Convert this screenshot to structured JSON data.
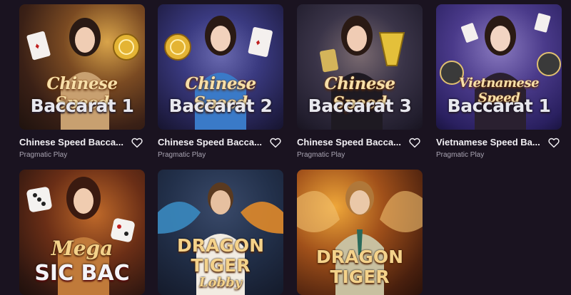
{
  "games": [
    {
      "name": "Chinese Speed Bacca...",
      "provider": "Pragmatic Play",
      "art_line1": "Chinese Speed",
      "art_line2": "Baccarat 1",
      "bg": "#4a2a1e",
      "bg2": "#b8862a"
    },
    {
      "name": "Chinese Speed Bacca...",
      "provider": "Pragmatic Play",
      "art_line1": "Chinese Speed",
      "art_line2": "Baccarat 2",
      "bg": "#2a2350",
      "bg2": "#3a6ab0"
    },
    {
      "name": "Chinese Speed Bacca...",
      "provider": "Pragmatic Play",
      "art_line1": "Chinese Speed",
      "art_line2": "Baccarat 3",
      "bg": "#2a2a3e",
      "bg2": "#6a5a2a"
    },
    {
      "name": "Vietnamese Speed Ba...",
      "provider": "Pragmatic Play",
      "art_line1": "Vietnamese Speed",
      "art_line2": "Baccarat 1",
      "bg": "#2a2a5a",
      "bg2": "#6a4aa0"
    },
    {
      "art_line1": "Mega",
      "art_line2": "SIC BAC",
      "bg": "#3a1a12",
      "bg2": "#a04a20"
    },
    {
      "art_line1": "DRAGON",
      "art_line2": "TIGER",
      "art_line3": "Lobby",
      "bg": "#1a2a3a",
      "bg2": "#c0702a"
    },
    {
      "art_line1": "DRAGON",
      "art_line2": "TIGER",
      "bg": "#3a1a0a",
      "bg2": "#e0902a"
    }
  ],
  "icons": {
    "favorite": "heart-outline-icon"
  }
}
